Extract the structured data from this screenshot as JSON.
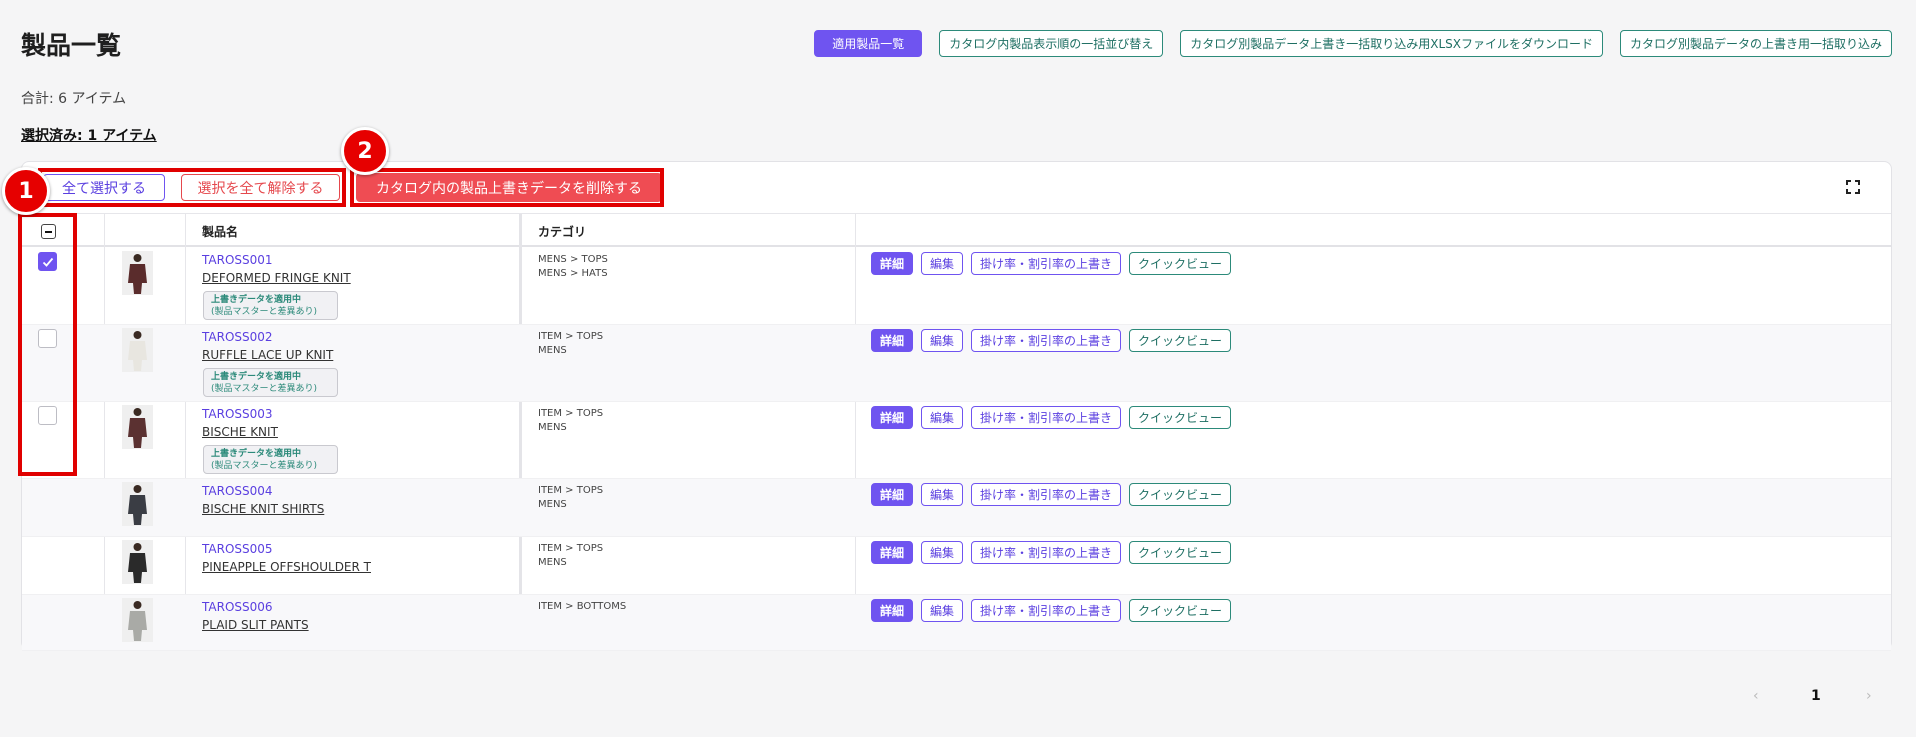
{
  "header": {
    "title": "製品一覧",
    "buttons": [
      "適用製品一覧",
      "カタログ内製品表示順の一括並び替え",
      "カタログ別製品データ上書き一括取り込み用XLSXファイルをダウンロード",
      "カタログ別製品データの上書き用一括取り込み"
    ]
  },
  "summary": {
    "total": "合計: 6 アイテム",
    "selected": "選択済み: 1 アイテム"
  },
  "toolbar": {
    "select_all": "全て選択する",
    "deselect_all": "選択を全て解除する",
    "delete_override": "カタログ内の製品上書きデータを削除する"
  },
  "table": {
    "columns": [
      "製品名",
      "カテゴリ"
    ],
    "action_labels": {
      "detail": "詳細",
      "edit": "編集",
      "rate": "掛け率・割引率の上書き",
      "quick": "クイックビュー"
    },
    "badge": {
      "line1": "上書きデータを適用中",
      "line2": "(製品マスターと差異あり)"
    },
    "rows": [
      {
        "code": "TAROSS001",
        "name": "DEFORMED FRINGE KNIT",
        "cat1": "MENS > TOPS",
        "cat2": "MENS > HATS",
        "checked": true,
        "badge": true
      },
      {
        "code": "TAROSS002",
        "name": "RUFFLE LACE UP KNIT",
        "cat1": "ITEM > TOPS",
        "cat2": "MENS",
        "checked": false,
        "badge": true
      },
      {
        "code": "TAROSS003",
        "name": "BISCHE KNIT",
        "cat1": "ITEM > TOPS",
        "cat2": "MENS",
        "checked": false,
        "badge": true
      },
      {
        "code": "TAROSS004",
        "name": "BISCHE KNIT SHIRTS",
        "cat1": "ITEM > TOPS",
        "cat2": "MENS",
        "checked": null,
        "badge": false
      },
      {
        "code": "TAROSS005",
        "name": "PINEAPPLE OFFSHOULDER T",
        "cat1": "ITEM > TOPS",
        "cat2": "MENS",
        "checked": null,
        "badge": false
      },
      {
        "code": "TAROSS006",
        "name": "PLAID SLIT PANTS",
        "cat1": "ITEM > BOTTOMS",
        "cat2": "",
        "checked": null,
        "badge": false
      }
    ]
  },
  "pagination": {
    "current": "1"
  },
  "annotations": {
    "marker1": "1",
    "marker2": "2"
  },
  "colors": {
    "primary": "#6f54f0",
    "danger": "#ef4c53",
    "teal": "#2c8a7a",
    "highlight": "#e00000"
  }
}
